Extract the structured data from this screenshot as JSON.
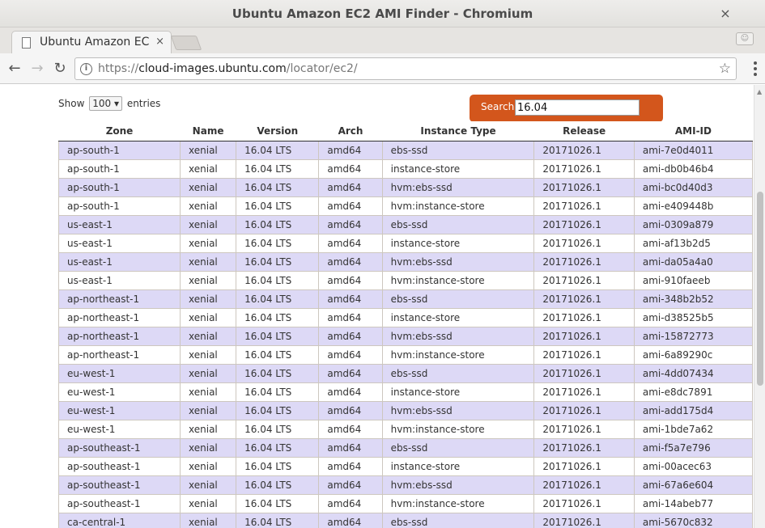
{
  "window": {
    "title": "Ubuntu Amazon EC2 AMI Finder - Chromium",
    "close_glyph": "×"
  },
  "tab": {
    "label": "Ubuntu Amazon EC",
    "close_glyph": "×"
  },
  "toolbar": {
    "url_scheme": "https://",
    "url_host": "cloud-images.ubuntu.com",
    "url_path": "/locator/ec2/"
  },
  "length": {
    "show_label": "Show",
    "selected": "100",
    "entries_label": "entries"
  },
  "search": {
    "label": "Search:",
    "value": "16.04"
  },
  "table": {
    "headers": [
      "Zone",
      "Name",
      "Version",
      "Arch",
      "Instance Type",
      "Release",
      "AMI-ID"
    ],
    "rows": [
      [
        "ap-south-1",
        "xenial",
        "16.04 LTS",
        "amd64",
        "ebs-ssd",
        "20171026.1",
        "ami-7e0d4011"
      ],
      [
        "ap-south-1",
        "xenial",
        "16.04 LTS",
        "amd64",
        "instance-store",
        "20171026.1",
        "ami-db0b46b4"
      ],
      [
        "ap-south-1",
        "xenial",
        "16.04 LTS",
        "amd64",
        "hvm:ebs-ssd",
        "20171026.1",
        "ami-bc0d40d3"
      ],
      [
        "ap-south-1",
        "xenial",
        "16.04 LTS",
        "amd64",
        "hvm:instance-store",
        "20171026.1",
        "ami-e409448b"
      ],
      [
        "us-east-1",
        "xenial",
        "16.04 LTS",
        "amd64",
        "ebs-ssd",
        "20171026.1",
        "ami-0309a879"
      ],
      [
        "us-east-1",
        "xenial",
        "16.04 LTS",
        "amd64",
        "instance-store",
        "20171026.1",
        "ami-af13b2d5"
      ],
      [
        "us-east-1",
        "xenial",
        "16.04 LTS",
        "amd64",
        "hvm:ebs-ssd",
        "20171026.1",
        "ami-da05a4a0"
      ],
      [
        "us-east-1",
        "xenial",
        "16.04 LTS",
        "amd64",
        "hvm:instance-store",
        "20171026.1",
        "ami-910faeeb"
      ],
      [
        "ap-northeast-1",
        "xenial",
        "16.04 LTS",
        "amd64",
        "ebs-ssd",
        "20171026.1",
        "ami-348b2b52"
      ],
      [
        "ap-northeast-1",
        "xenial",
        "16.04 LTS",
        "amd64",
        "instance-store",
        "20171026.1",
        "ami-d38525b5"
      ],
      [
        "ap-northeast-1",
        "xenial",
        "16.04 LTS",
        "amd64",
        "hvm:ebs-ssd",
        "20171026.1",
        "ami-15872773"
      ],
      [
        "ap-northeast-1",
        "xenial",
        "16.04 LTS",
        "amd64",
        "hvm:instance-store",
        "20171026.1",
        "ami-6a89290c"
      ],
      [
        "eu-west-1",
        "xenial",
        "16.04 LTS",
        "amd64",
        "ebs-ssd",
        "20171026.1",
        "ami-4dd07434"
      ],
      [
        "eu-west-1",
        "xenial",
        "16.04 LTS",
        "amd64",
        "instance-store",
        "20171026.1",
        "ami-e8dc7891"
      ],
      [
        "eu-west-1",
        "xenial",
        "16.04 LTS",
        "amd64",
        "hvm:ebs-ssd",
        "20171026.1",
        "ami-add175d4"
      ],
      [
        "eu-west-1",
        "xenial",
        "16.04 LTS",
        "amd64",
        "hvm:instance-store",
        "20171026.1",
        "ami-1bde7a62"
      ],
      [
        "ap-southeast-1",
        "xenial",
        "16.04 LTS",
        "amd64",
        "ebs-ssd",
        "20171026.1",
        "ami-f5a7e796"
      ],
      [
        "ap-southeast-1",
        "xenial",
        "16.04 LTS",
        "amd64",
        "instance-store",
        "20171026.1",
        "ami-00acec63"
      ],
      [
        "ap-southeast-1",
        "xenial",
        "16.04 LTS",
        "amd64",
        "hvm:ebs-ssd",
        "20171026.1",
        "ami-67a6e604"
      ],
      [
        "ap-southeast-1",
        "xenial",
        "16.04 LTS",
        "amd64",
        "hvm:instance-store",
        "20171026.1",
        "ami-14abeb77"
      ],
      [
        "ca-central-1",
        "xenial",
        "16.04 LTS",
        "amd64",
        "ebs-ssd",
        "20171026.1",
        "ami-5670c832"
      ]
    ]
  },
  "colors": {
    "search_bg": "#d3561c",
    "row_odd": "#ddd9f6",
    "row_even": "#ffffff"
  }
}
